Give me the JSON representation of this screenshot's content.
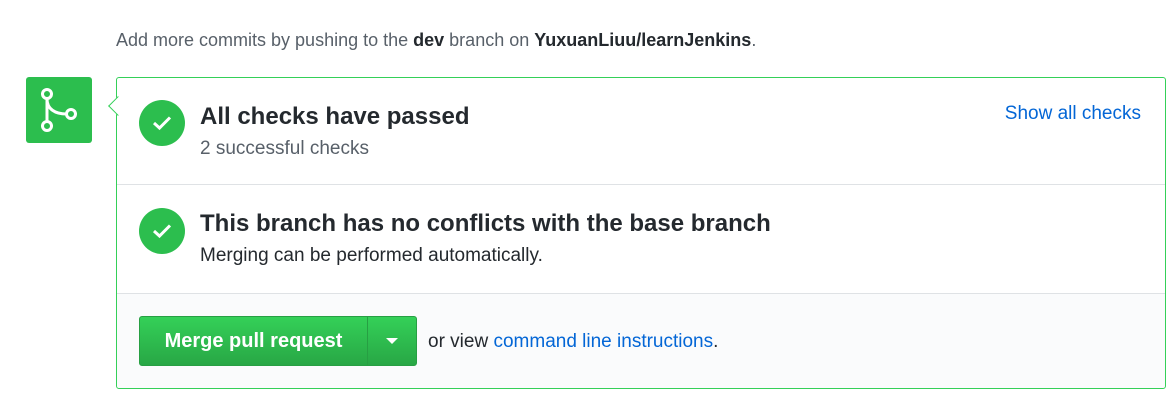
{
  "hint": {
    "prefix": "Add more commits by pushing to the ",
    "branch": "dev",
    "middle": " branch on ",
    "repo": "YuxuanLiuu/learnJenkins",
    "suffix": "."
  },
  "checks": {
    "title": "All checks have passed",
    "subtitle": "2 successful checks",
    "show_all_link": "Show all checks"
  },
  "conflicts": {
    "title": "This branch has no conflicts with the base branch",
    "subtitle": "Merging can be performed automatically."
  },
  "merge": {
    "button_label": "Merge pull request",
    "alt_prefix": "or view ",
    "alt_link": "command line instructions",
    "alt_suffix": "."
  },
  "colors": {
    "success_green": "#2cbe4e",
    "border_green": "#34d058",
    "link_blue": "#0366d6"
  },
  "icons": {
    "merge_icon": "git-merge-icon",
    "check_icon": "check-icon",
    "caret_icon": "triangle-down-icon"
  }
}
